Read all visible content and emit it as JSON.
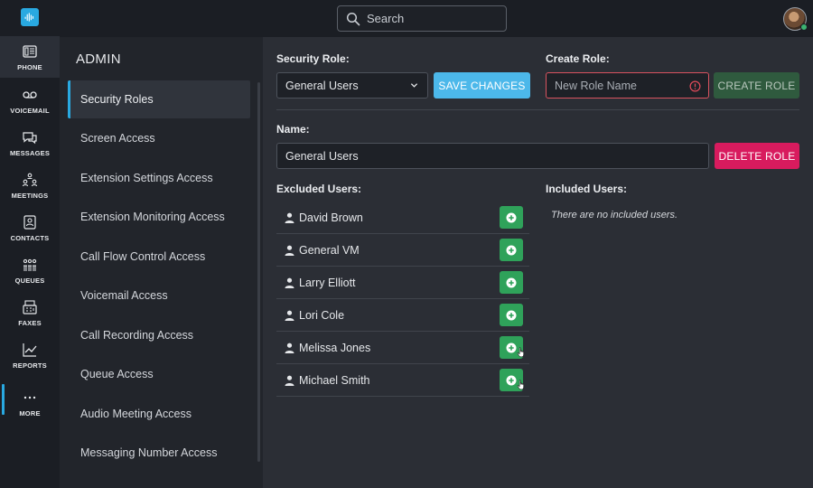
{
  "search": {
    "placeholder": "Search"
  },
  "nav": {
    "items": [
      {
        "label": "PHONE",
        "icon": "phone-icon"
      },
      {
        "label": "VOICEMAIL",
        "icon": "voicemail-icon"
      },
      {
        "label": "MESSAGES",
        "icon": "messages-icon"
      },
      {
        "label": "MEETINGS",
        "icon": "meetings-icon"
      },
      {
        "label": "CONTACTS",
        "icon": "contacts-icon"
      },
      {
        "label": "QUEUES",
        "icon": "queues-icon"
      },
      {
        "label": "FAXES",
        "icon": "fax-icon"
      },
      {
        "label": "REPORTS",
        "icon": "reports-icon"
      },
      {
        "label": "MORE",
        "icon": "more-icon"
      }
    ]
  },
  "admin": {
    "title": "ADMIN",
    "items": [
      "Security Roles",
      "Screen Access",
      "Extension Settings Access",
      "Extension Monitoring Access",
      "Call Flow Control Access",
      "Voicemail Access",
      "Call Recording Access",
      "Queue Access",
      "Audio Meeting Access",
      "Messaging Number Access"
    ]
  },
  "main": {
    "security_role_label": "Security Role:",
    "security_role_value": "General Users",
    "save_label": "SAVE CHANGES",
    "create_role_label": "Create Role:",
    "new_role_placeholder": "New Role Name",
    "create_label": "CREATE ROLE",
    "name_label": "Name:",
    "name_value": "General Users",
    "delete_label": "DELETE ROLE",
    "excluded_label": "Excluded Users:",
    "included_label": "Included Users:",
    "excluded_users": [
      "David Brown",
      "General VM",
      "Larry Elliott",
      "Lori Cole",
      "Melissa Jones",
      "Michael Smith"
    ],
    "included_empty": "There are no included users."
  },
  "colors": {
    "accent": "#29a9e1",
    "save": "#4cb8ea",
    "delete": "#d81b5e",
    "add": "#2fa25a",
    "create": "#2f5a3e"
  }
}
